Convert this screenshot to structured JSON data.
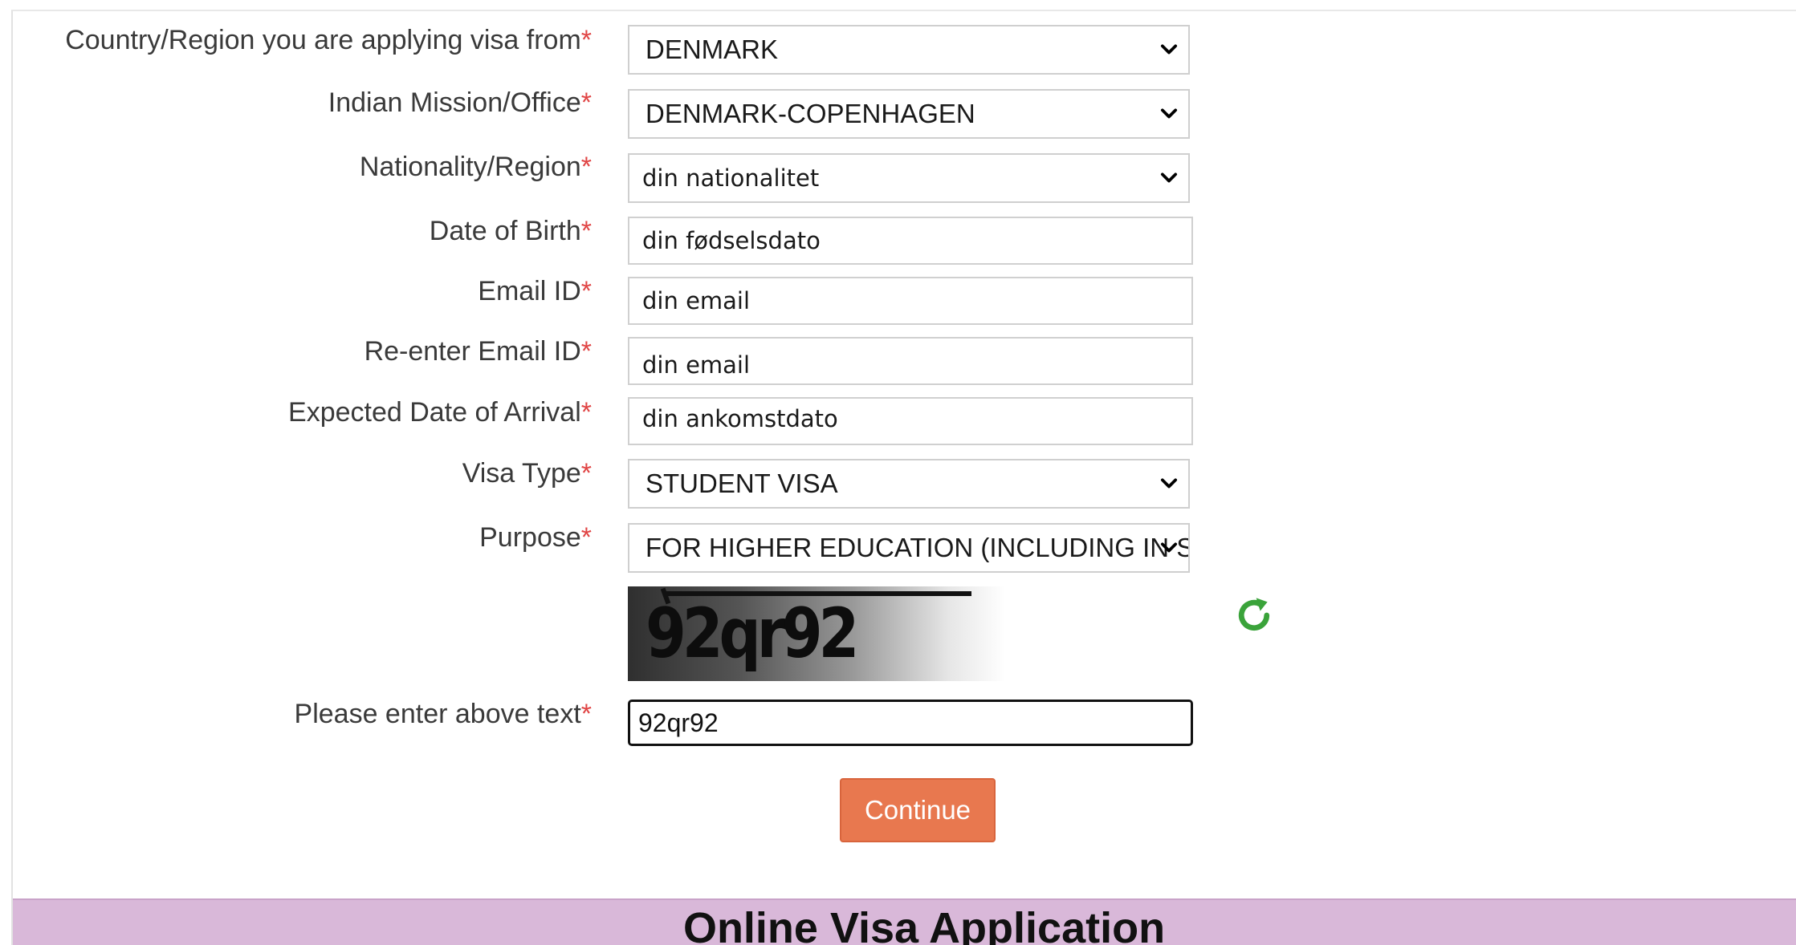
{
  "form": {
    "country": {
      "label": "Country/Region you are applying visa from",
      "value": "DENMARK"
    },
    "mission": {
      "label": "Indian Mission/Office",
      "value": "DENMARK-COPENHAGEN"
    },
    "nationality": {
      "label": "Nationality/Region",
      "value": "din nationalitet"
    },
    "dob": {
      "label": "Date of Birth",
      "value": "din fødselsdato"
    },
    "email": {
      "label": "Email ID",
      "value": "din email"
    },
    "email_confirm": {
      "label": "Re-enter Email ID",
      "value": "din email"
    },
    "arrival": {
      "label": "Expected Date of Arrival",
      "value": "din ankomstdato"
    },
    "visa_type": {
      "label": "Visa Type",
      "value": "STUDENT VISA"
    },
    "purpose": {
      "label": "Purpose",
      "value": "FOR HIGHER EDUCATION (INCLUDING IN SCIENCE)"
    },
    "captcha": {
      "image_text": "92qr92",
      "label": "Please enter above text",
      "value": "92qr92"
    },
    "required_marker": "*",
    "continue_label": "Continue"
  },
  "banner": {
    "title": "Online Visa Application"
  },
  "colors": {
    "accent_button": "#e8784f",
    "refresh_icon": "#3aa33a",
    "banner_bg": "#d9b8d9",
    "required": "#e04444"
  },
  "icons": {
    "select_arrow": "chevron-down-icon",
    "refresh": "refresh-icon"
  }
}
